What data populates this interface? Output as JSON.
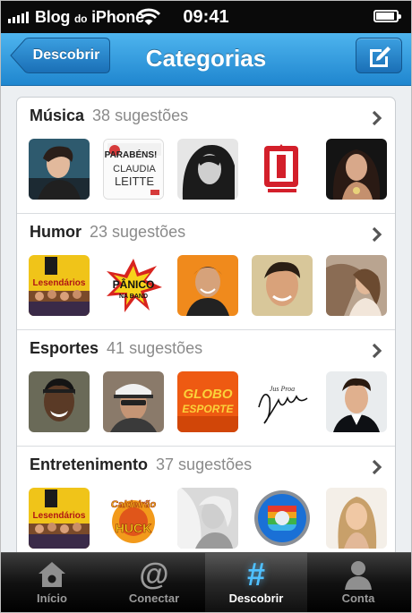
{
  "status_bar": {
    "carrier_main": "Blog",
    "carrier_small": "do",
    "carrier_end": "iPhone",
    "time": "09:41",
    "signal_icon": "signal-bars-icon",
    "wifi_icon": "wifi-icon",
    "battery_icon": "battery-icon"
  },
  "nav": {
    "back_label": "Descobrir",
    "title": "Categorias",
    "compose_icon": "compose-icon"
  },
  "categories": [
    {
      "name": "Música",
      "count": "38 sugestões"
    },
    {
      "name": "Humor",
      "count": "23 sugestões"
    },
    {
      "name": "Esportes",
      "count": "41 sugestões"
    },
    {
      "name": "Entretenimento",
      "count": "37 sugestões"
    }
  ],
  "thumb_text": {
    "parabens": "PARABÉNS!",
    "claudia": "CLAUDIA",
    "leitte": "LEITTE",
    "lesendarios": "Lesendários",
    "panico": "PÂNICO",
    "na_band": "NA BAND",
    "globo": "GLOBO",
    "esporte": "ESPORTE",
    "signature": "Jus Proa",
    "caldeirao": "Caldeirão",
    "huck": "HUCK"
  },
  "tabs": [
    {
      "label": "Início",
      "icon": "home-icon"
    },
    {
      "label": "Conectar",
      "icon": "at-icon"
    },
    {
      "label": "Descobrir",
      "icon": "hash-icon"
    },
    {
      "label": "Conta",
      "icon": "person-icon"
    }
  ],
  "colors": {
    "nav_blue": "#1f86cf",
    "active_tab_icon": "#4fc0ff",
    "count_gray": "#8a8a8a"
  }
}
